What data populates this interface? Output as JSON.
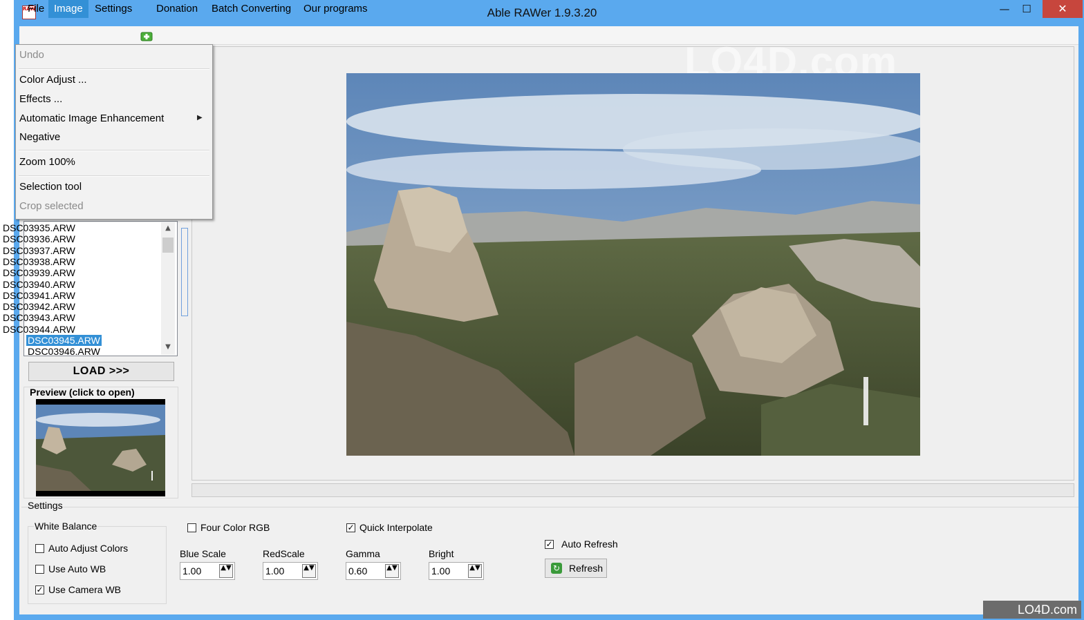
{
  "window": {
    "title": "Able RAWer 1.9.3.20",
    "icon_text": "RAW",
    "controls": {
      "minimize": "—",
      "maximize": "☐",
      "close": "✕"
    }
  },
  "menubar": [
    {
      "label": "File"
    },
    {
      "label": "Image",
      "active": true
    },
    {
      "label": "Settings"
    },
    {
      "label": "Donation",
      "icon": "donation-icon"
    },
    {
      "label": "Batch Converting"
    },
    {
      "label": "Our programs"
    }
  ],
  "image_menu": {
    "undo": "Undo",
    "color_adjust": "Color Adjust ...",
    "effects": "Effects ...",
    "auto_enhancement": "Automatic Image Enhancement",
    "negative": "Negative",
    "zoom": "Zoom 100%",
    "selection_tool": "Selection tool",
    "crop_selected": "Crop selected",
    "submenu_arrow": "▶"
  },
  "files": {
    "items": [
      "DSC03935.ARW",
      "DSC03936.ARW",
      "DSC03937.ARW",
      "DSC03938.ARW",
      "DSC03939.ARW",
      "DSC03940.ARW",
      "DSC03941.ARW",
      "DSC03942.ARW",
      "DSC03943.ARW",
      "DSC03944.ARW",
      "DSC03945.ARW",
      "DSC03946.ARW"
    ],
    "selected": "DSC03945.ARW",
    "scroll_up": "▲",
    "scroll_down": "▼"
  },
  "load_button": "LOAD >>>",
  "preview_label": "Preview (click to open)",
  "watermark": "LO4D.com",
  "settings": {
    "title": "Settings",
    "white_balance": {
      "title": "White Balance",
      "auto_adjust_colors": {
        "label": "Auto Adjust Colors",
        "checked": false
      },
      "use_auto_wb": {
        "label": "Use Auto WB",
        "checked": false
      },
      "use_camera_wb": {
        "label": "Use Camera WB",
        "checked": true
      }
    },
    "four_color_rgb": {
      "label": "Four Color RGB",
      "checked": false
    },
    "quick_interpolate": {
      "label": "Quick Interpolate",
      "checked": true
    },
    "auto_refresh": {
      "label": "Auto Refresh",
      "checked": true
    },
    "blue_scale": {
      "label": "Blue Scale",
      "value": "1.00"
    },
    "red_scale": {
      "label": "RedScale",
      "value": "1.00"
    },
    "gamma": {
      "label": "Gamma",
      "value": "0.60"
    },
    "bright": {
      "label": "Bright",
      "value": "1.00"
    },
    "refresh_button": "Refresh",
    "check_mark": "✓",
    "spin_glyph": "▲▼"
  },
  "footer_logo": "LO4D.com",
  "colors": {
    "titlebar": "#5aa9ee",
    "accent": "#3390d6",
    "close": "#c7463d"
  }
}
